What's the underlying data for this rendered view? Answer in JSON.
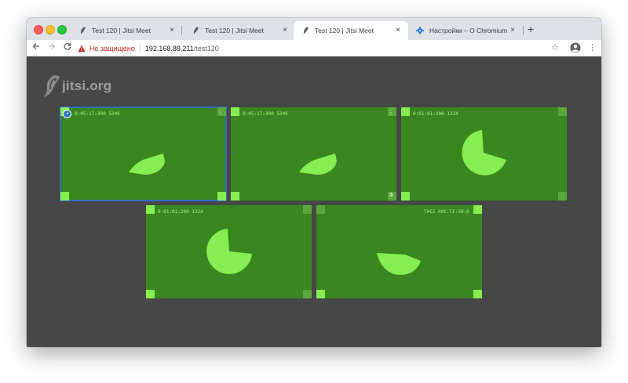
{
  "browser": {
    "tabs": [
      {
        "title": "Test 120 | Jitsi Meet",
        "favicon": "jitsi-icon",
        "active": false
      },
      {
        "title": "Test 120 | Jitsi Meet",
        "favicon": "jitsi-icon",
        "active": false
      },
      {
        "title": "Test 120 | Jitsi Meet",
        "favicon": "jitsi-icon",
        "active": true
      },
      {
        "title": "Настройки – О Chromium",
        "favicon": "gear-icon",
        "active": false
      }
    ],
    "new_tab_label": "+",
    "close_glyph": "×",
    "address": {
      "security_label": "Не защищено",
      "host": "192.168.88.211",
      "path": "/test120"
    }
  },
  "page": {
    "logo_text": "jitsi.org",
    "tiles": [
      {
        "timestamp": "0:05:17:300 5346",
        "selected": true,
        "mirrored": false
      },
      {
        "timestamp": "0:05:17:300 5346",
        "selected": false,
        "mirrored": false
      },
      {
        "timestamp": "0:01:01:200 1324",
        "selected": false,
        "mirrored": false
      },
      {
        "timestamp": "0:01:01:200 1324",
        "selected": false,
        "mirrored": false
      },
      {
        "timestamp": "0:05:17:300 5347",
        "selected": false,
        "mirrored": true
      }
    ],
    "tile_menu_glyph": "⋮"
  },
  "colors": {
    "tile_bg": "#3a8720",
    "pie": "#86ee52",
    "page_bg": "#474747",
    "accent": "#2f6ec9",
    "insecure": "#c5221f"
  }
}
